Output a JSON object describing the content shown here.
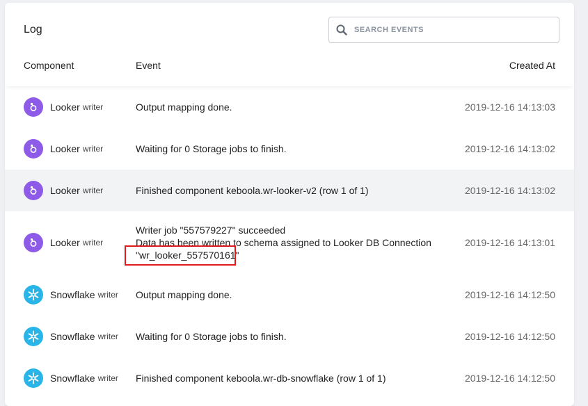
{
  "log": {
    "title": "Log",
    "search": {
      "placeholder": "SEARCH EVENTS",
      "value": ""
    },
    "columns": {
      "component": "Component",
      "event": "Event",
      "created_at": "Created At"
    },
    "rows": [
      {
        "component": "Looker",
        "type": "writer",
        "icon": "looker-icon",
        "event_lines": [
          "Output mapping done."
        ],
        "created_at": "2019-12-16 14:13:03"
      },
      {
        "component": "Looker",
        "type": "writer",
        "icon": "looker-icon",
        "event_lines": [
          "Waiting for 0 Storage jobs to finish."
        ],
        "created_at": "2019-12-16 14:13:02"
      },
      {
        "component": "Looker",
        "type": "writer",
        "icon": "looker-icon",
        "event_lines": [
          "Finished component keboola.wr-looker-v2 (row 1 of 1)"
        ],
        "created_at": "2019-12-16 14:13:02"
      },
      {
        "component": "Looker",
        "type": "writer",
        "icon": "looker-icon",
        "event_lines": [
          "Writer job \"557579227\" succeeded",
          "Data has been written to schema assigned to Looker DB Connection",
          "\"wr_looker_557570161\""
        ],
        "created_at": "2019-12-16 14:13:01"
      },
      {
        "component": "Snowflake",
        "type": "writer",
        "icon": "snowflake-icon",
        "event_lines": [
          "Output mapping done."
        ],
        "created_at": "2019-12-16 14:12:50"
      },
      {
        "component": "Snowflake",
        "type": "writer",
        "icon": "snowflake-icon",
        "event_lines": [
          "Waiting for 0 Storage jobs to finish."
        ],
        "created_at": "2019-12-16 14:12:50"
      },
      {
        "component": "Snowflake",
        "type": "writer",
        "icon": "snowflake-icon",
        "event_lines": [
          "Finished component keboola.wr-db-snowflake (row 1 of 1)"
        ],
        "created_at": "2019-12-16 14:12:50"
      }
    ]
  },
  "colors": {
    "looker": "#8e5be8",
    "snowflake": "#29b5e8",
    "highlight_box": "#e01a1a",
    "hover_row": "#f2f3f5"
  }
}
